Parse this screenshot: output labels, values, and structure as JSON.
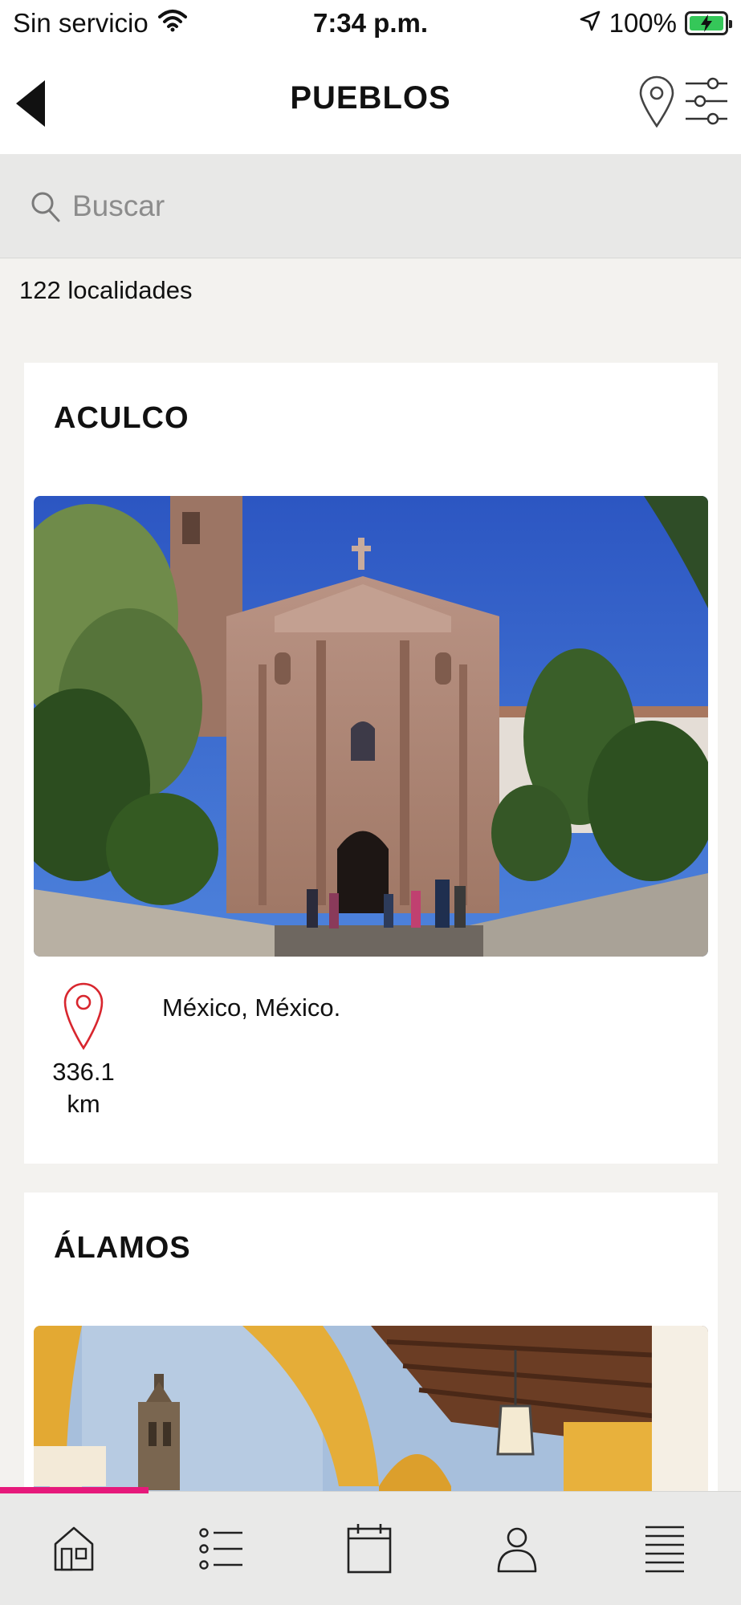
{
  "status_bar": {
    "carrier": "Sin servicio",
    "time": "7:34 p.m.",
    "battery": "100%",
    "battery_color": "#35c759"
  },
  "nav": {
    "title": "PUEBLOS",
    "back_icon": "back-arrow-icon",
    "map_icon": "map-pin-icon",
    "filter_icon": "filter-sliders-icon"
  },
  "search": {
    "placeholder": "Buscar",
    "value": ""
  },
  "results": {
    "count_label": "122 localidades"
  },
  "cards": [
    {
      "title": "ACULCO",
      "location": "México, México.",
      "distance_value": "336.1",
      "distance_unit": "km",
      "image_icon": "church-photo"
    },
    {
      "title": "ÁLAMOS",
      "image_icon": "arcade-photo"
    }
  ],
  "tab_bar": {
    "active_color": "#e6197b",
    "items": [
      {
        "icon": "home-icon",
        "active": true
      },
      {
        "icon": "list-icon",
        "active": false
      },
      {
        "icon": "calendar-icon",
        "active": false
      },
      {
        "icon": "profile-icon",
        "active": false
      },
      {
        "icon": "menu-icon",
        "active": false
      }
    ]
  },
  "colors": {
    "accent": "#e6197b",
    "pin_red": "#d8262e",
    "background": "#f3f2ef"
  }
}
